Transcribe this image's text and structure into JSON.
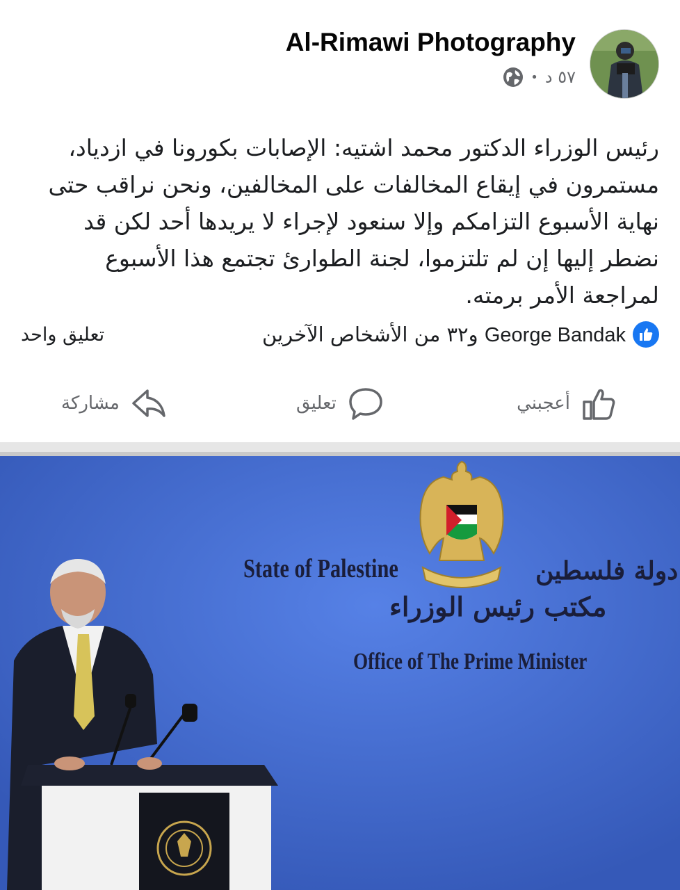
{
  "post": {
    "author": "Al-Rimawi Photography",
    "time": "٥٧ د",
    "separator": "•",
    "text": "رئيس الوزراء الدكتور محمد اشتيه: الإصابات بكورونا في ازدياد، مستمرون في إيقاع المخالفات على المخالفين، ونحن نراقب حتى نهاية الأسبوع التزامكم وإلا سنعود لإجراء لا يريدها أحد لكن قد نضطر إليها إن لم تلتزموا، لجنة الطوارئ تجتمع هذا الأسبوع لمراجعة الأمر برمته."
  },
  "stats": {
    "reactor_name": "George Bandak",
    "reactor_others": "و٣٢ من الأشخاص الآخرين",
    "comments": "تعليق واحد"
  },
  "actions": {
    "like": "أعجبني",
    "comment": "تعليق",
    "share": "مشاركة"
  },
  "photo": {
    "state_en": "State of Palestine",
    "state_ar": "دولة فلسطين",
    "office_ar": "مكتب رئيس الوزراء",
    "office_en": "Office of The Prime Minister",
    "emblem_label": "فلسطين"
  },
  "colors": {
    "like_blue": "#1877f2",
    "backdrop_blue": "#3f6fd8",
    "muted": "#65676b"
  },
  "icons": [
    "globe-icon",
    "like-badge-icon",
    "thumbs-up-icon",
    "comment-icon",
    "share-icon"
  ]
}
